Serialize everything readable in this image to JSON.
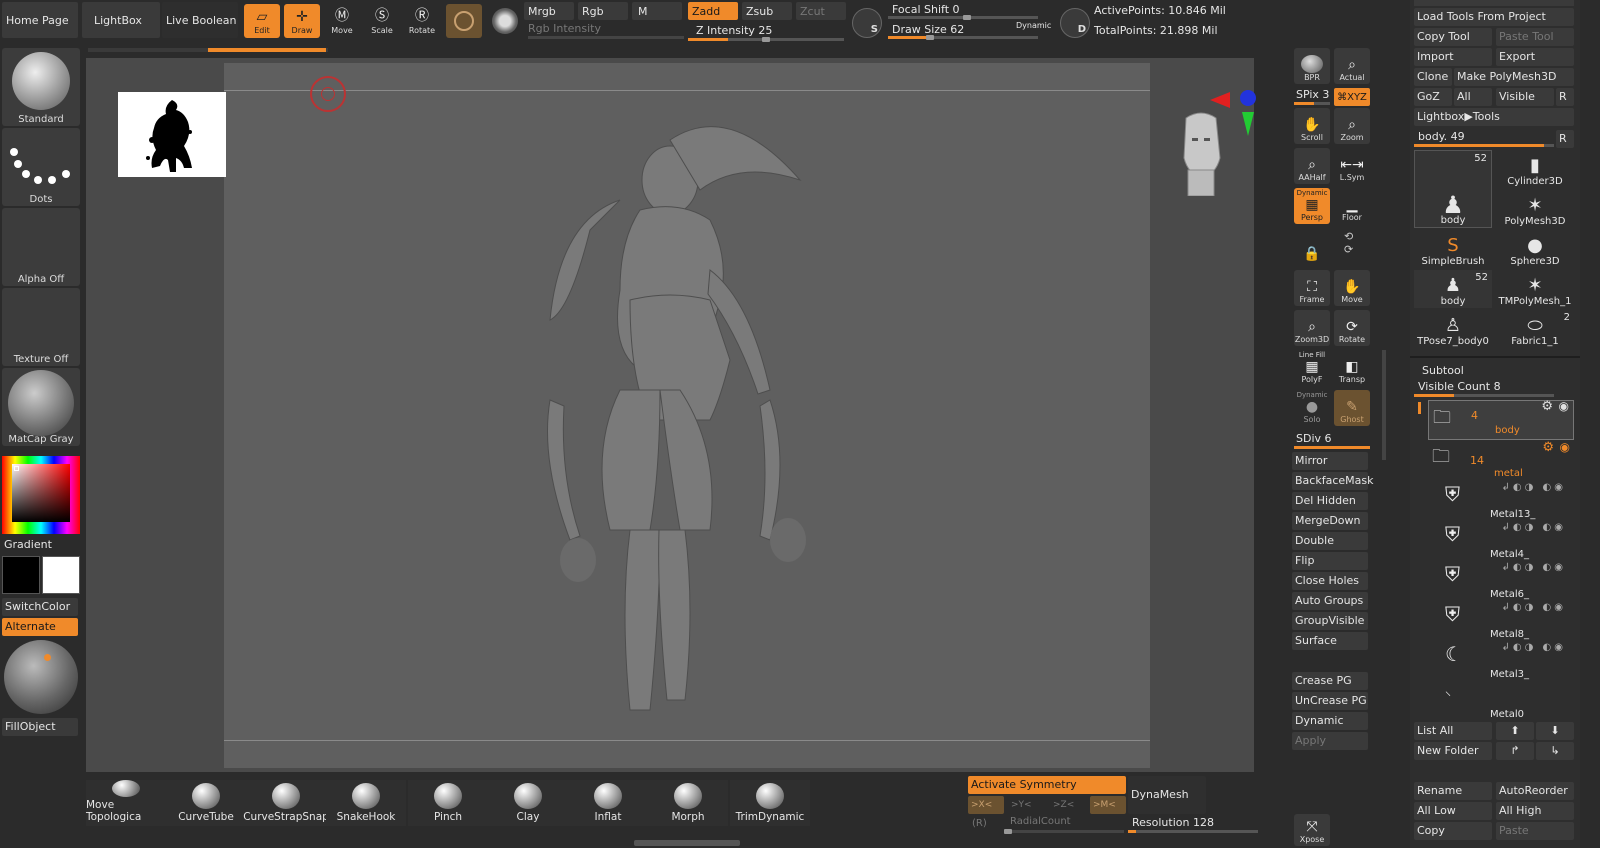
{
  "top_bar": {
    "home_page": "Home Page",
    "lightbox": "LightBox",
    "live_boolean": "Live Boolean",
    "edit": "Edit",
    "draw": "Draw",
    "move": "Move",
    "scale": "Scale",
    "rotate": "Rotate",
    "mrgb": "Mrgb",
    "rgb": "Rgb",
    "m": "M",
    "rgb_intensity": "Rgb Intensity",
    "zadd": "Zadd",
    "zsub": "Zsub",
    "zcut": "Zcut",
    "z_intensity": "Z Intensity 25",
    "z_intensity_value": 25,
    "focal_shift": "Focal Shift 0",
    "focal_shift_value": 0,
    "draw_size": "Draw Size 62",
    "draw_size_value": 62,
    "dynamic": "Dynamic",
    "active_points": "ActivePoints: 10.846 Mil",
    "total_points": "TotalPoints: 21.898 Mil"
  },
  "left_panel": {
    "standard": "Standard",
    "dots": "Dots",
    "alpha_off": "Alpha Off",
    "texture_off": "Texture Off",
    "matcap_gray": "MatCap Gray",
    "gradient": "Gradient",
    "switch_color": "SwitchColor",
    "alternate": "Alternate",
    "fill_object": "FillObject"
  },
  "right_shelf": {
    "bpr": "BPR",
    "actual": "Actual",
    "spix": "SPix 3",
    "xyz": "⌘XYZ",
    "scroll": "Scroll",
    "zoom": "Zoom",
    "aahalf": "AAHalf",
    "lsym": "L.Sym",
    "persp": "Persp",
    "persp_dyn": "Dynamic",
    "floor": "Floor",
    "frame": "Frame",
    "move": "Move",
    "zoom3d": "Zoom3D",
    "rotate": "Rotate",
    "polyf": "PolyF",
    "line_fill": "Line Fill",
    "transp": "Transp",
    "solo": "Solo",
    "solo_dyn": "Dynamic",
    "ghost": "Ghost",
    "sdiv": "SDiv 6",
    "mirror": "Mirror",
    "backface_mask": "BackfaceMask",
    "del_hidden": "Del Hidden",
    "merge_down": "MergeDown",
    "double": "Double",
    "flip": "Flip",
    "close_holes": "Close Holes",
    "auto_groups": "Auto Groups",
    "group_visible": "GroupVisible",
    "surface": "Surface",
    "crease_pg": "Crease PG",
    "uncrease_pg": "UnCrease PG",
    "dynamic": "Dynamic",
    "apply": "Apply",
    "xpose": "Xpose"
  },
  "tool_panel": {
    "load_tools_from_project": "Load Tools From Project",
    "copy_tool": "Copy Tool",
    "paste_tool": "Paste Tool",
    "import": "Import",
    "export": "Export",
    "clone": "Clone",
    "make_polymesh3d": "Make PolyMesh3D",
    "goz": "GoZ",
    "all": "All",
    "visible": "Visible",
    "r": "R",
    "lightbox_tools": "Lightbox▶Tools",
    "body_slider": "body. 49",
    "tools": [
      {
        "name": "body",
        "count": "52"
      },
      {
        "name": "Cylinder3D",
        "count": ""
      },
      {
        "name": "PolyMesh3D",
        "count": ""
      },
      {
        "name": "SimpleBrush",
        "count": ""
      },
      {
        "name": "Sphere3D",
        "count": ""
      },
      {
        "name": "body",
        "count": "52"
      },
      {
        "name": "TMPolyMesh_1",
        "count": ""
      },
      {
        "name": "TPose7_body0",
        "count": ""
      },
      {
        "name": "Fabric1_1",
        "count": "2"
      }
    ],
    "subtool_title": "Subtool",
    "visible_count": "Visible Count 8",
    "body_folder_count": "4",
    "body_folder_name": "body",
    "metal_folder_count": "14",
    "metal_folder_name": "metal",
    "subtools": [
      "Metal13_",
      "Metal4_",
      "Metal6_",
      "Metal8_",
      "Metal3_",
      "Metal0"
    ],
    "list_all": "List All",
    "new_folder": "New Folder",
    "rename": "Rename",
    "auto_reorder": "AutoReorder",
    "all_low": "All Low",
    "all_high": "All High",
    "copy": "Copy",
    "paste": "Paste"
  },
  "bottom_bar": {
    "brushes": [
      "Move Topologica",
      "CurveTube",
      "CurveStrapSnap",
      "SnakeHook",
      "Pinch",
      "Clay",
      "Inflat",
      "Morph",
      "TrimDynamic"
    ],
    "activate_symmetry": "Activate Symmetry",
    "sym_x": ">X<",
    "sym_y": ">Y<",
    "sym_z": ">Z<",
    "sym_m": ">M<",
    "r": "(R)",
    "radial_count": "RadialCount",
    "dynamesh": "DynaMesh",
    "resolution": "Resolution 128",
    "resolution_value": 128
  },
  "colors": {
    "accent": "#f08a2a",
    "bg": "#2b2b2b",
    "canvas": "#5e5e5e",
    "button": "#3a3a3a"
  }
}
